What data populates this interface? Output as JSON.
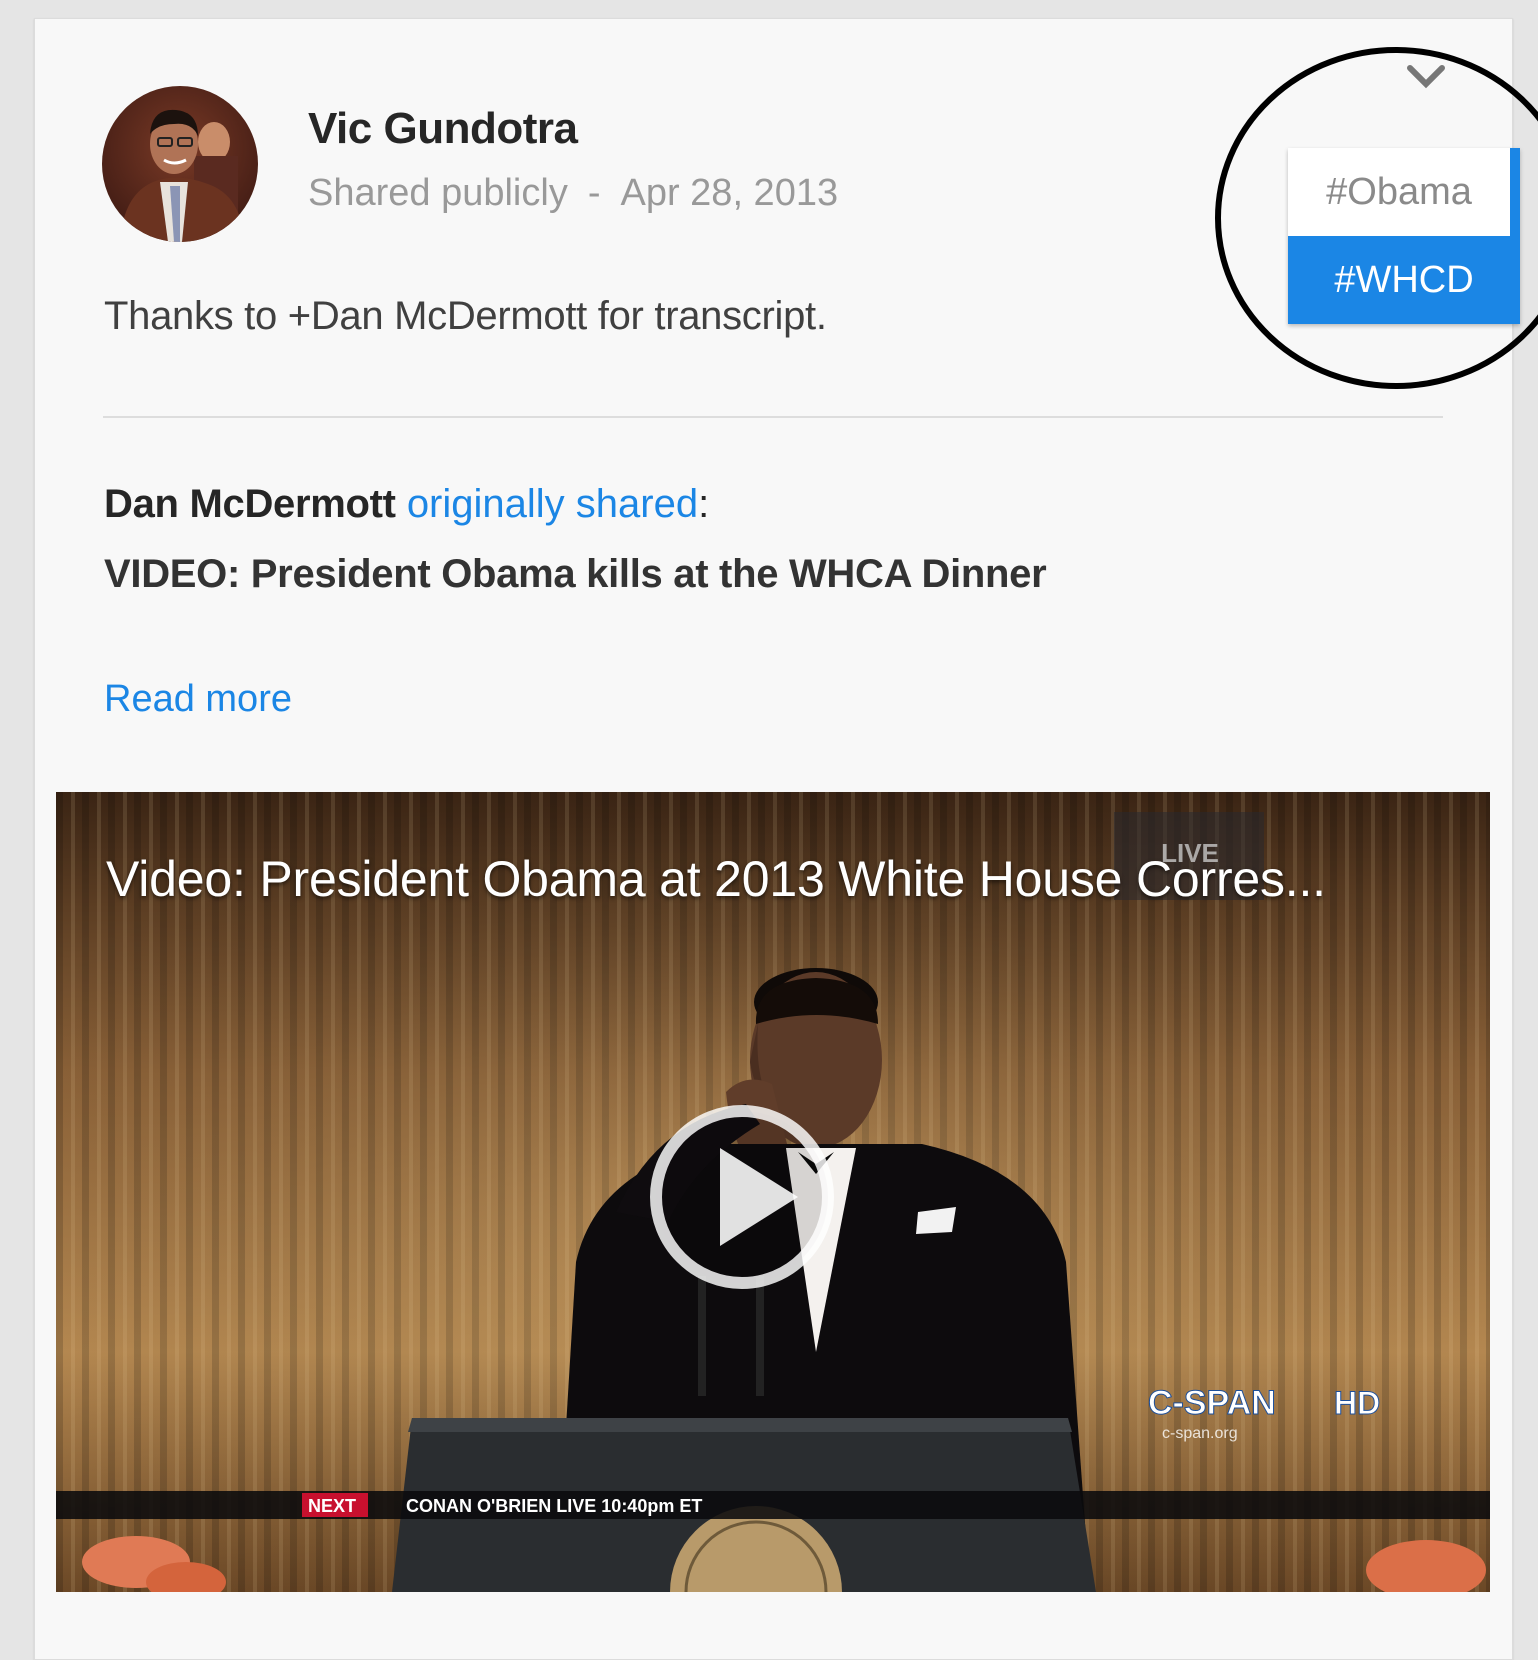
{
  "post": {
    "author": "Vic Gundotra",
    "visibility": "Shared publicly",
    "separator": "-",
    "date": "Apr 28, 2013",
    "text": "Thanks to +Dan McDermott for transcript."
  },
  "reshare": {
    "original_author": "Dan McDermott",
    "link_text": "originally shared",
    "colon": ":",
    "headline": "VIDEO: President Obama kills at the WHCA Dinner",
    "read_more": "Read more"
  },
  "video": {
    "title": "Video: President Obama at 2013 White House Corres...",
    "overlay": {
      "live": "LIVE",
      "network": "C-SPAN",
      "network_site": "c-span.org",
      "hd": "HD",
      "ticker_next": "NEXT",
      "ticker_text": "CONAN O'BRIEN  LIVE 10:40pm ET"
    }
  },
  "menu": {
    "items": [
      {
        "label": "#Obama",
        "selected": false
      },
      {
        "label": "#WHCD",
        "selected": true
      }
    ]
  },
  "icons": {
    "menu_toggle": "chevron-down-icon",
    "play": "play-icon",
    "avatar": "profile-photo"
  },
  "colors": {
    "accent": "#1b86e5",
    "card_bg": "#f8f8f8",
    "page_bg": "#e5e5e5"
  }
}
